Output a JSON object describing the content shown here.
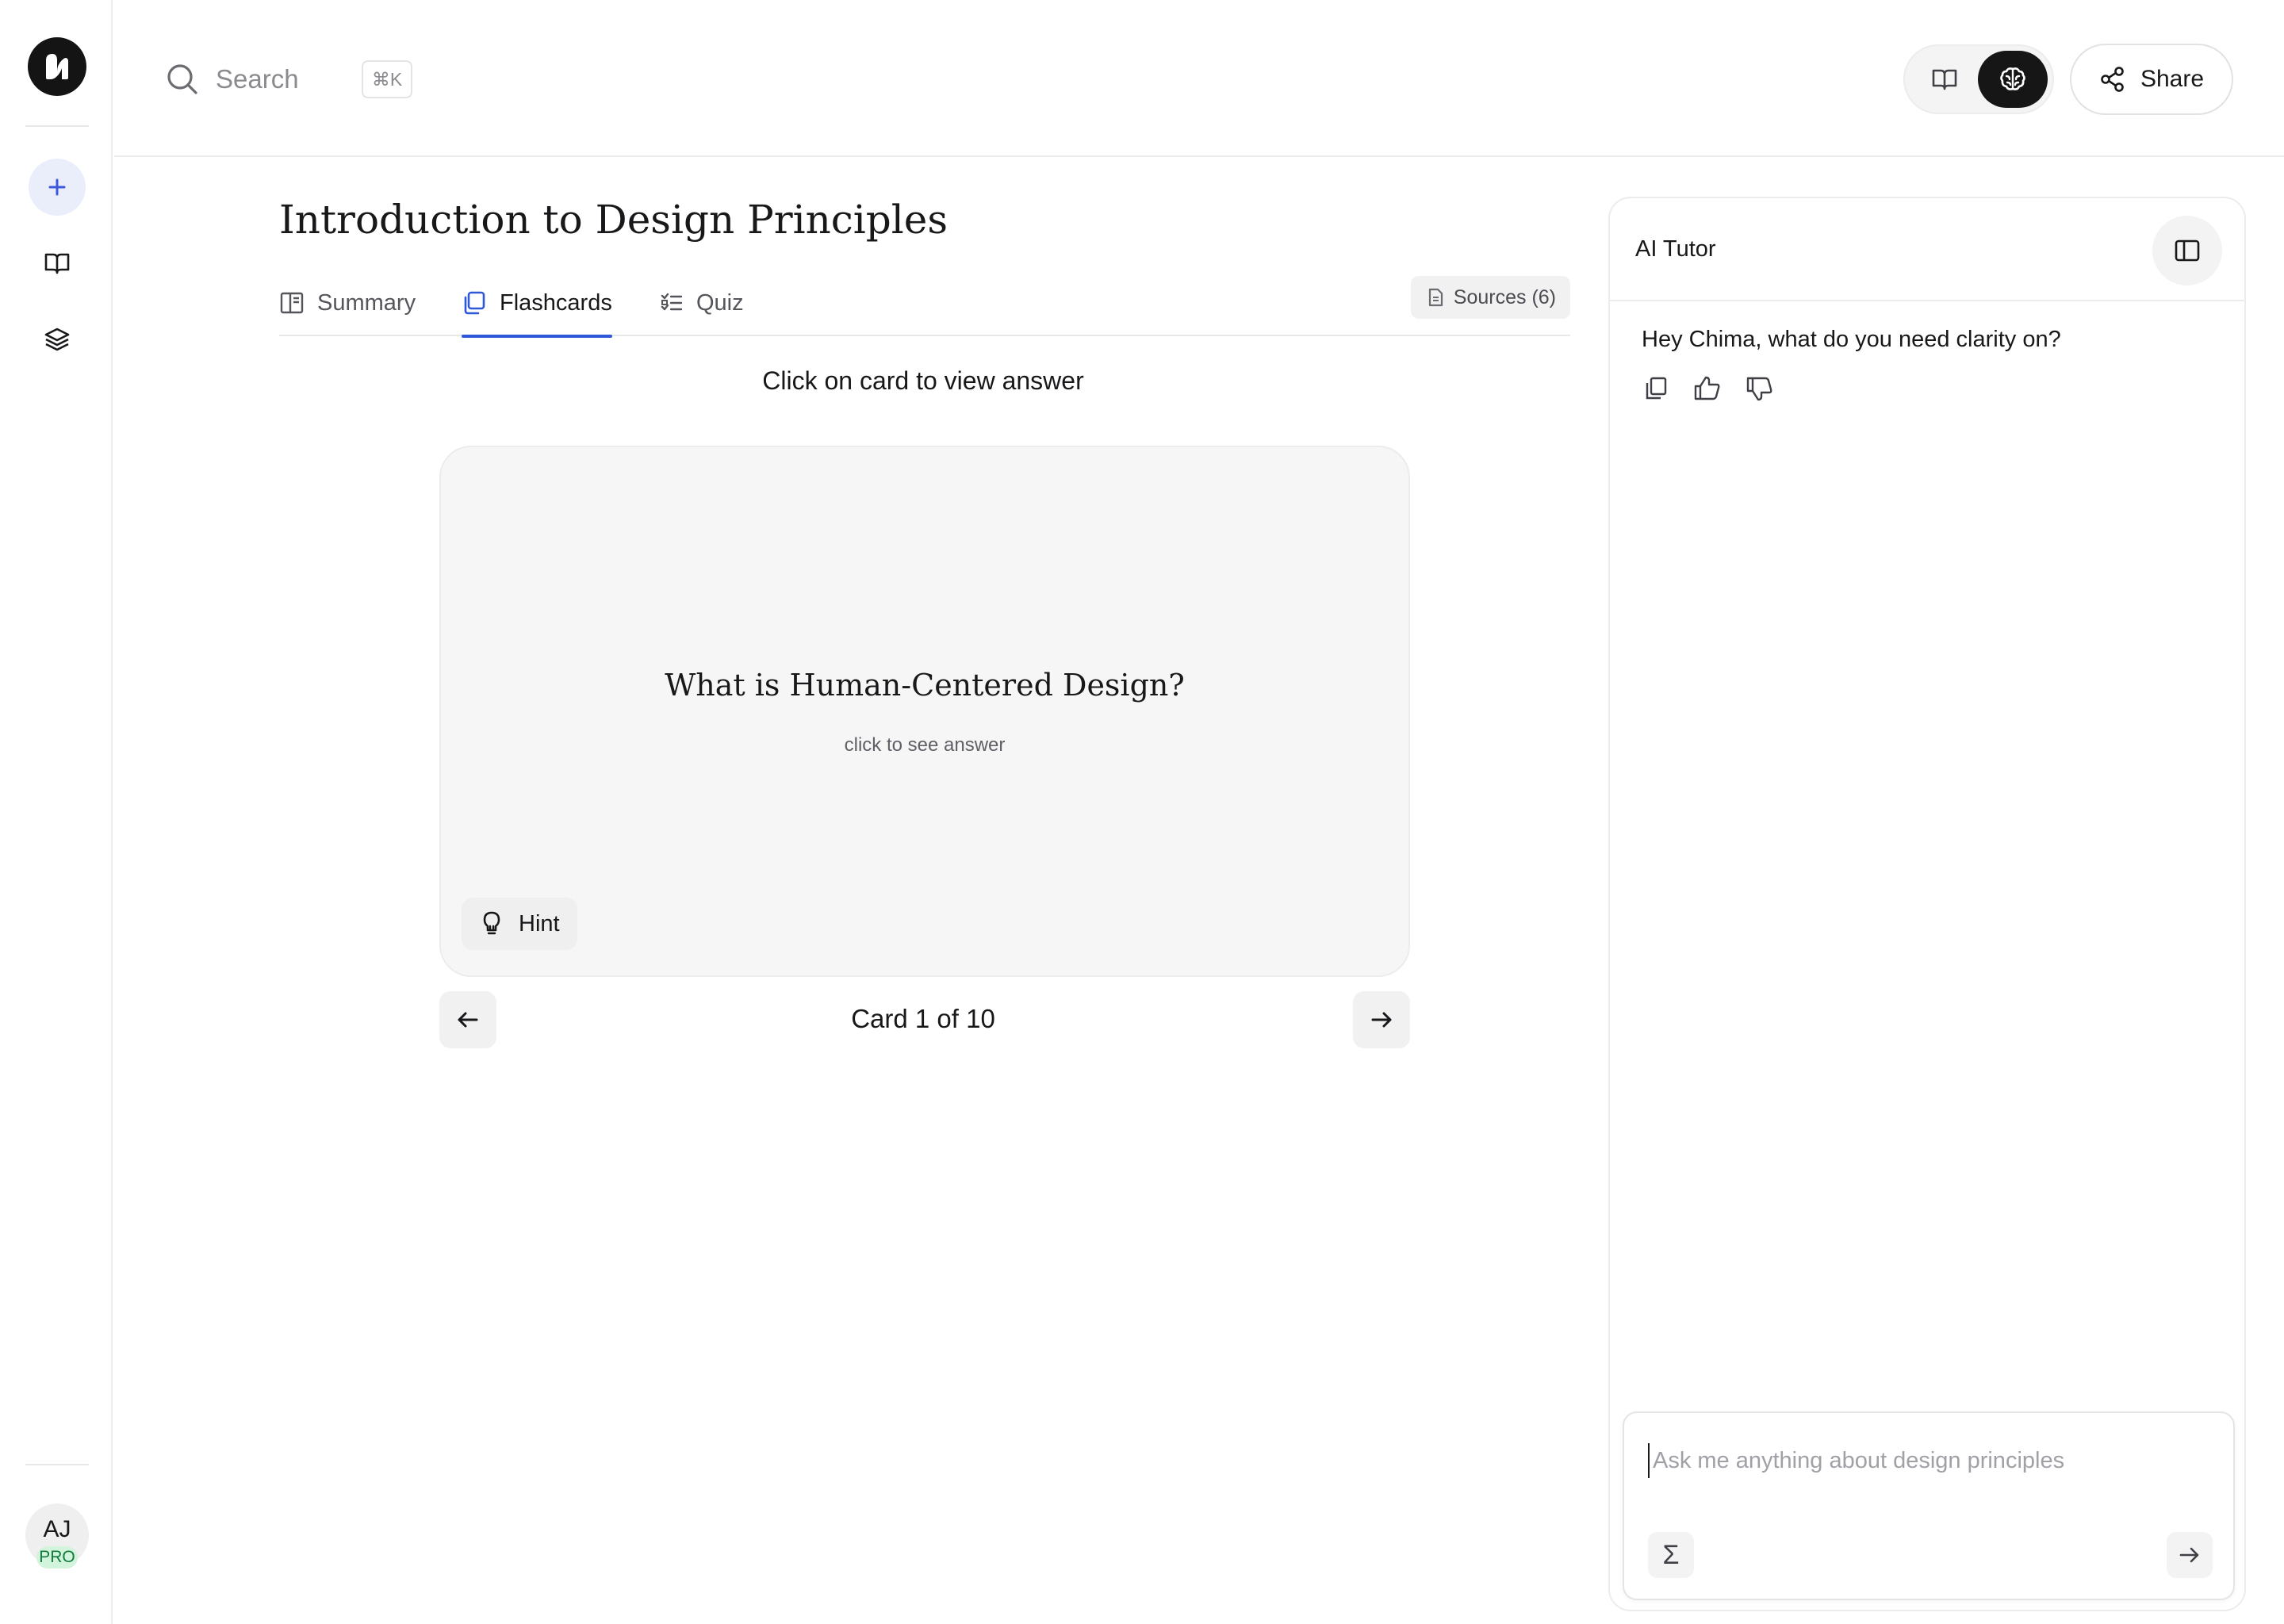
{
  "app": {
    "user_initials": "AJ",
    "plan_badge": "PRO",
    "accent_color": "#2f58d6",
    "badge_color": "#137a3c"
  },
  "sidebar": {
    "items": [
      {
        "icon": "plus-icon",
        "label": "New"
      },
      {
        "icon": "book-open-icon",
        "label": "Library"
      },
      {
        "icon": "layers-icon",
        "label": "Stack"
      }
    ]
  },
  "topbar": {
    "search_placeholder": "Search",
    "search_shortcut": "⌘K",
    "view_toggle": [
      "book-open-icon",
      "brain-icon"
    ],
    "share_label": "Share"
  },
  "page": {
    "title": "Introduction to Design Principles",
    "tabs": [
      {
        "label": "Summary",
        "icon": "summary-icon",
        "active": false
      },
      {
        "label": "Flashcards",
        "icon": "flashcards-icon",
        "active": true
      },
      {
        "label": "Quiz",
        "icon": "quiz-icon",
        "active": false
      }
    ],
    "sources_label": "Sources (6)"
  },
  "flashcards": {
    "instruction": "Click on card to view answer",
    "question": "What is Human-Centered Design?",
    "sub": "click to see answer",
    "hint_label": "Hint",
    "counter": "Card 1 of 10",
    "current_card": 1,
    "total_cards": 10
  },
  "tutor": {
    "title": "AI Tutor",
    "message": "Hey Chima, what do you need clarity on?",
    "input_placeholder": "Ask me anything about design principles",
    "sigma_label": "Σ"
  }
}
